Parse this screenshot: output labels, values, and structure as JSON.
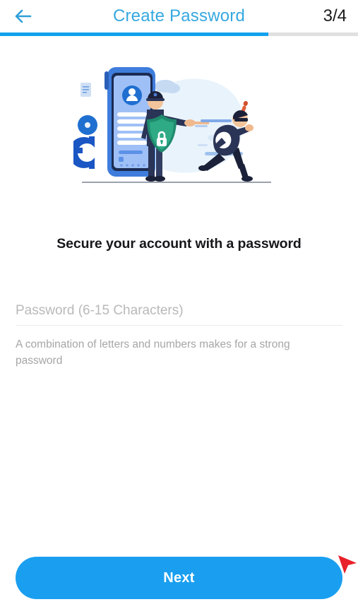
{
  "header": {
    "back_icon": "arrow-left-icon",
    "title": "Create Password",
    "page_counter": "3/4",
    "title_color": "#35a8e0"
  },
  "progress": {
    "percent": 75,
    "fill_color": "#11a2ec",
    "track_color": "#e0e0e0"
  },
  "illustration": {
    "name": "account-security-illustration",
    "elements": [
      "smartphone-profile-icon",
      "police-officer-icon",
      "shield-lock-icon",
      "running-thief-icon",
      "gear-icon",
      "document-icon",
      "cloud-icon"
    ],
    "shield_color": "#1f8a6d",
    "officer_color": "#2a3456",
    "phone_color": "#3e7ddc"
  },
  "main": {
    "headline": "Secure your account with a password",
    "password_field": {
      "placeholder": "Password (6-15 Characters)",
      "value": ""
    },
    "helper_text": "A combination of letters and numbers makes for a strong password"
  },
  "footer": {
    "next_label": "Next",
    "next_color": "#1a9ff0",
    "cursor_icon": "mouse-cursor-icon",
    "cursor_color": "#e8202a"
  }
}
